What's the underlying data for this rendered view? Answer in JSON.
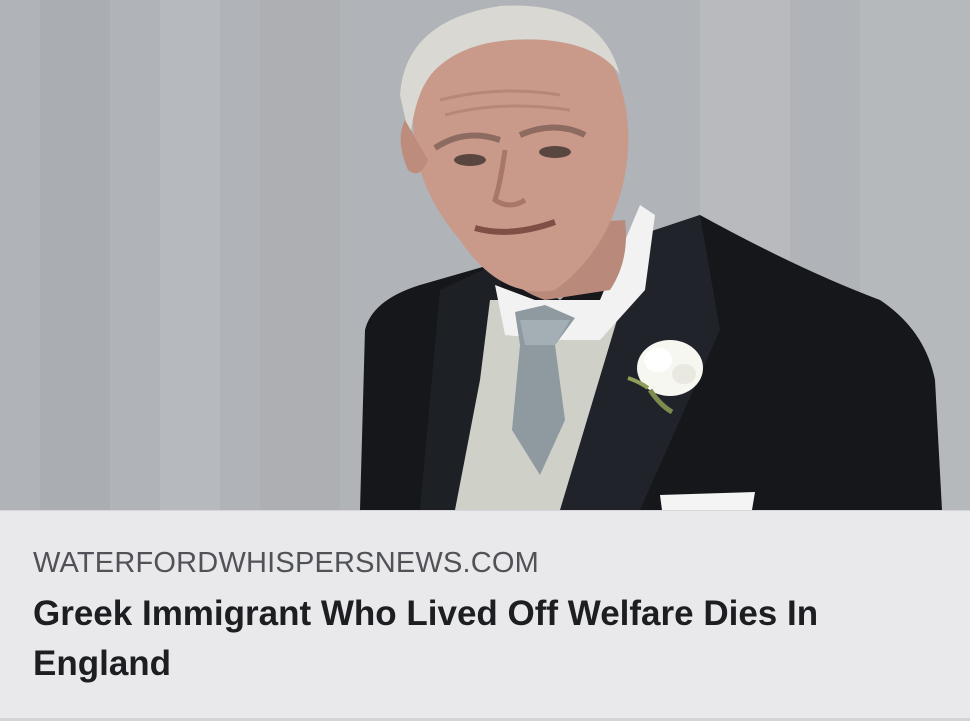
{
  "link_preview": {
    "image": {
      "description_icon": "photo-image",
      "colors": {
        "backdrop": "#b0b3b7",
        "suit": "#15171b",
        "shirt": "#f2f2f2",
        "waistcoat": "#cfd0c8",
        "tie": "#8e9aa0",
        "skin": "#c99a8a",
        "flower": "#f7f7f2"
      }
    },
    "domain": "WATERFORDWHISPERSNEWS.COM",
    "headline": "Greek Immigrant Who Lived Off Welfare Dies In England"
  }
}
